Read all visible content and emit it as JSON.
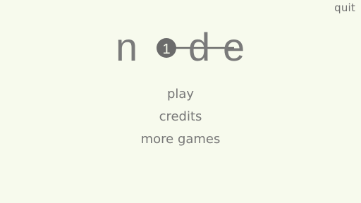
{
  "header": {
    "quit_label": "quit"
  },
  "logo": {
    "letter_n": "n",
    "node_number": "1",
    "letter_d": "d",
    "letter_e": "e",
    "text_color": "#7a7a7a",
    "node_color": "#6b6b6b",
    "node_text_color": "#f7faed"
  },
  "menu": {
    "items": [
      {
        "label": "play"
      },
      {
        "label": "credits"
      },
      {
        "label": "more games"
      }
    ]
  },
  "colors": {
    "background": "#f7faed",
    "text": "#777777"
  }
}
